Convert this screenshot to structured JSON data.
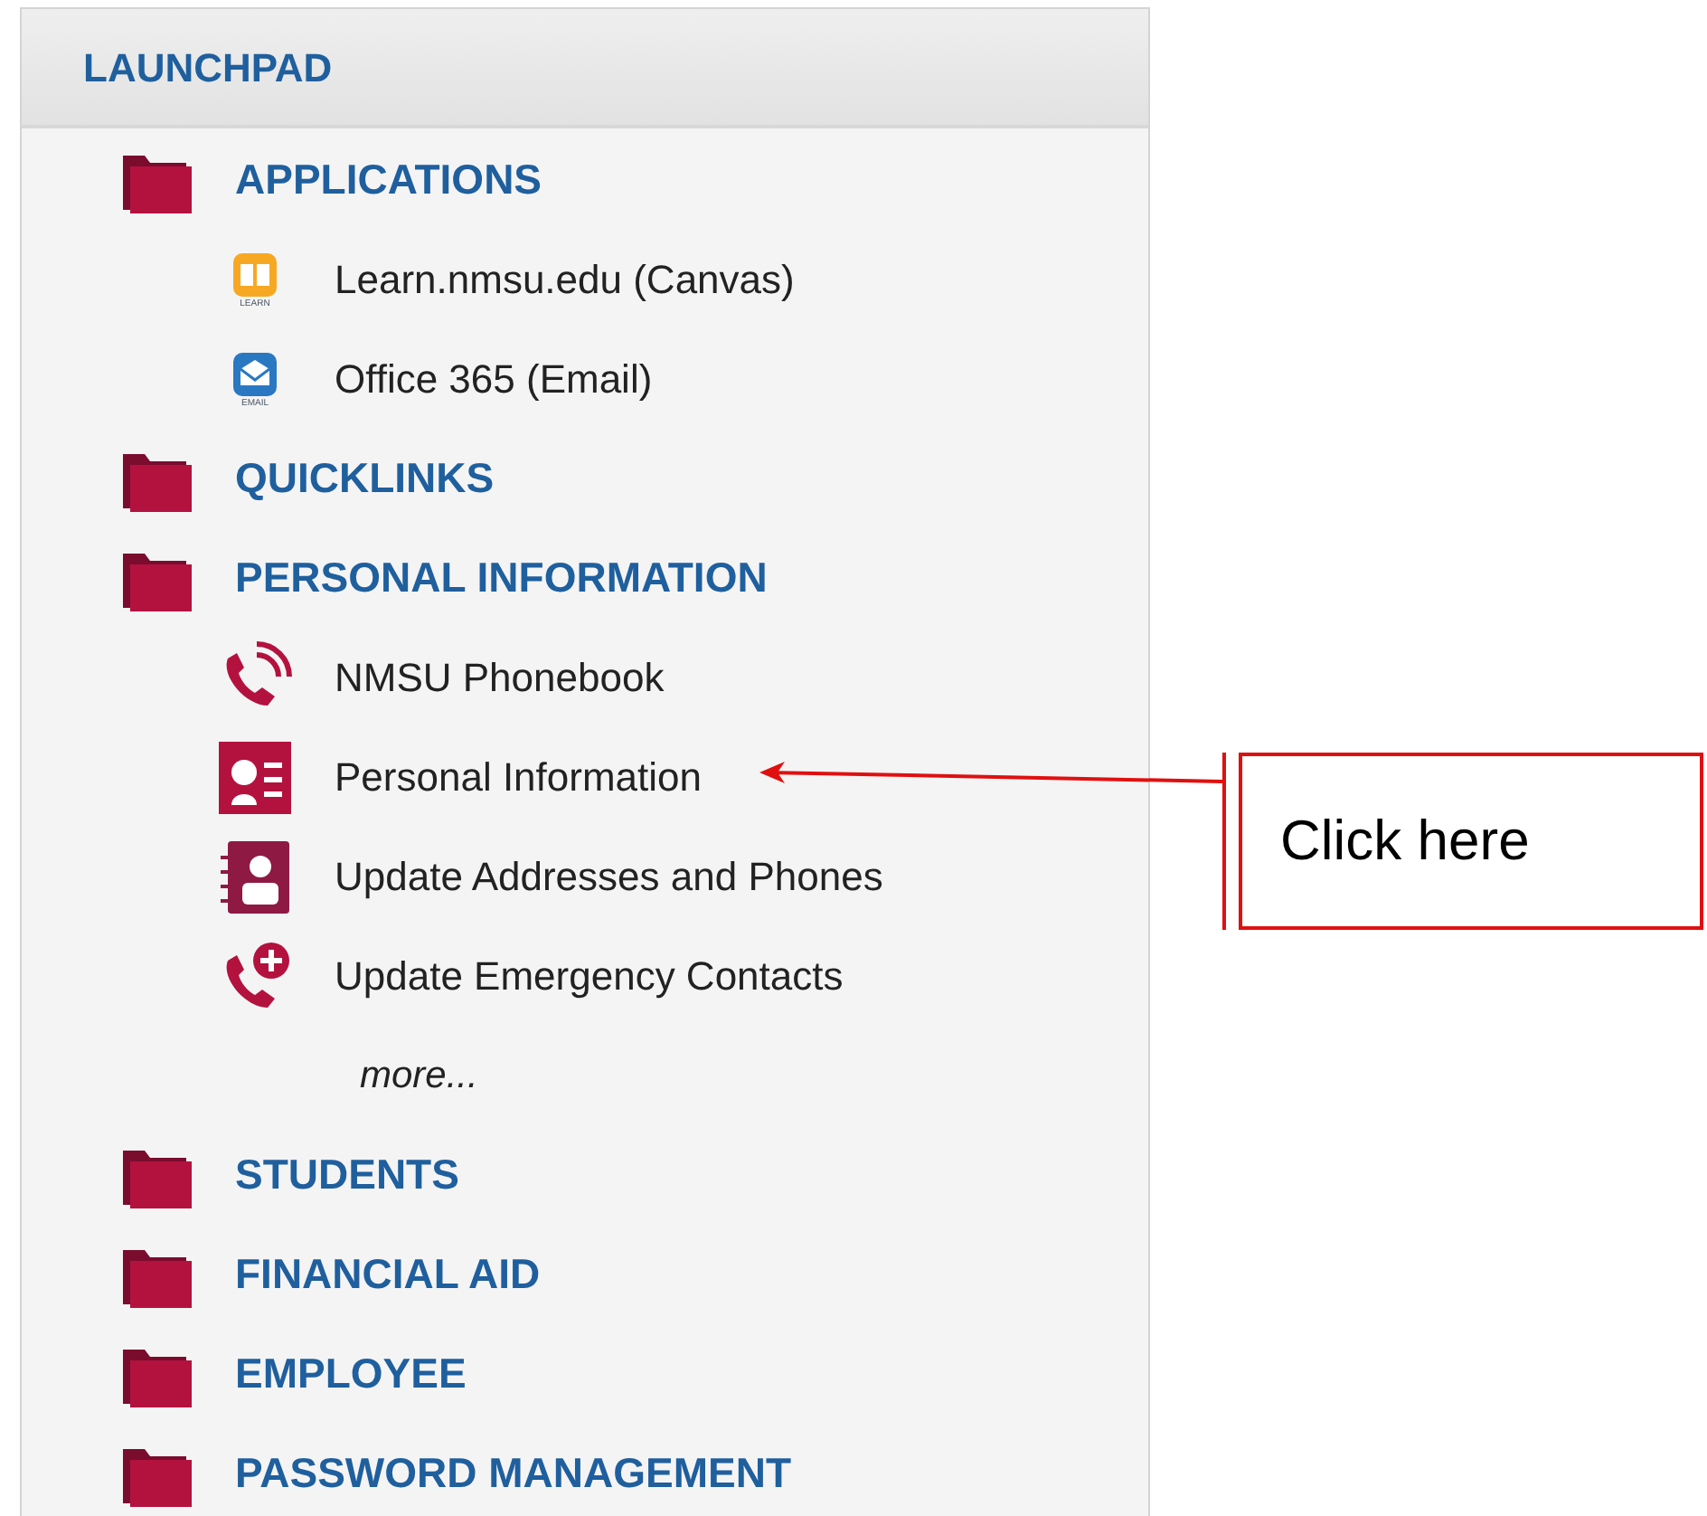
{
  "panel": {
    "title": "LAUNCHPAD"
  },
  "sections": [
    {
      "label": "APPLICATIONS",
      "items": [
        {
          "kind": "link",
          "icon_caption": "LEARN",
          "label": "Learn.nmsu.edu (Canvas)"
        },
        {
          "kind": "link",
          "icon_caption": "EMAIL",
          "label": "Office 365 (Email)"
        }
      ]
    },
    {
      "label": "QUICKLINKS"
    },
    {
      "label": "PERSONAL INFORMATION",
      "items": [
        {
          "kind": "link",
          "label": "NMSU Phonebook"
        },
        {
          "kind": "link",
          "label": "Personal Information"
        },
        {
          "kind": "link",
          "label": "Update Addresses and Phones"
        },
        {
          "kind": "link",
          "label": "Update Emergency Contacts"
        },
        {
          "kind": "more",
          "label": "more..."
        }
      ]
    },
    {
      "label": "STUDENTS"
    },
    {
      "label": "FINANCIAL AID"
    },
    {
      "label": "EMPLOYEE"
    },
    {
      "label": "PASSWORD MANAGEMENT"
    }
  ],
  "callout": {
    "text": "Click here"
  }
}
